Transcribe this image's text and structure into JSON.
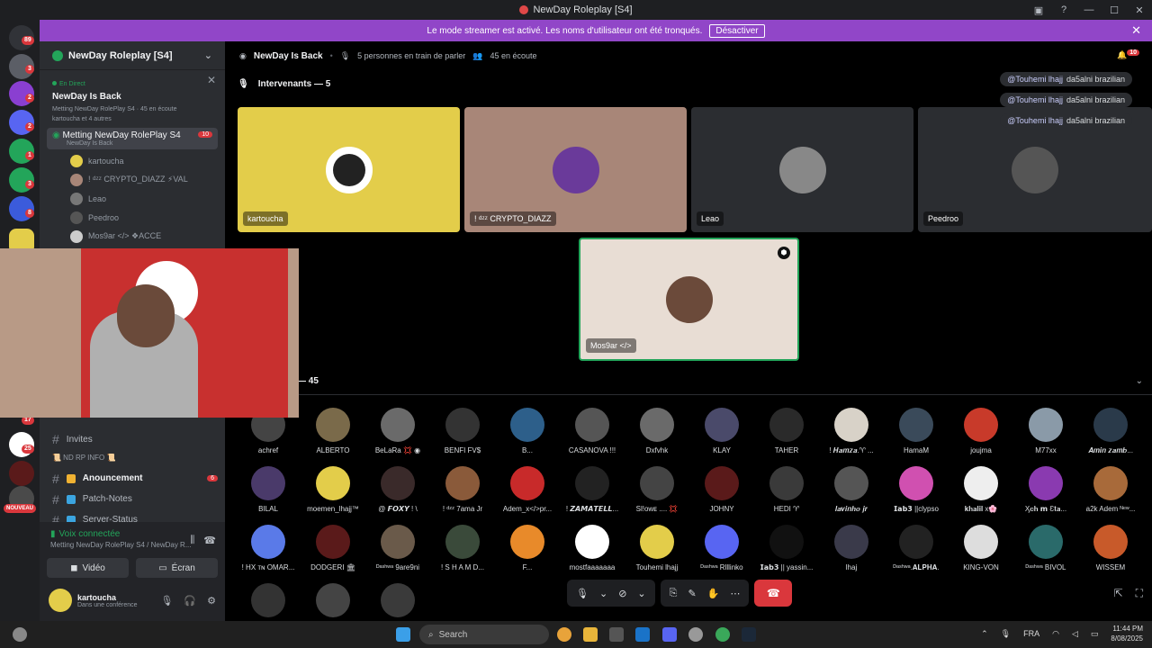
{
  "window": {
    "title": "NewDay Roleplay [S4]"
  },
  "banner": {
    "text": "Le mode streamer est activé. Les noms d'utilisateur ont été tronqués.",
    "button": "Désactiver"
  },
  "guild_badges": [
    "89",
    "3",
    "2",
    "2",
    "1",
    "3",
    "8",
    "17",
    "25",
    "NOUVEAU"
  ],
  "sidebar": {
    "server_name": "NewDay Roleplay [S4]",
    "live_label": "En Direct",
    "stage_title": "NewDay Is Back",
    "stage_meta": "Metting NewDay RolePlay S4 · 45 en écoute",
    "stage_users": "kartoucha et 4 autres",
    "active_channel": "Metting NewDay RolePlay S4",
    "active_channel_sub": "NewDay Is Back",
    "active_badge": "10",
    "members": [
      "kartoucha",
      "! ᵈᶻᶻ CRYPTO_DIAZZ ⚡VAL",
      "Leao",
      "Peedroo",
      "Mos9ar </> ❖ACCE"
    ],
    "category": "📜 ND RP INFO 📜",
    "invites": "Invites",
    "channels": [
      {
        "label": "Anouncement",
        "badge": "6"
      },
      {
        "label": "Patch-Notes",
        "badge": ""
      },
      {
        "label": "Server-Status",
        "badge": ""
      }
    ],
    "voice_status": "Voix connectée",
    "voice_sub": "Metting NewDay RolePlay S4 / NewDay R...",
    "video_btn": "Vidéo",
    "screen_btn": "Écran",
    "user_name": "kartoucha",
    "user_status": "Dans une conférence"
  },
  "topbar": {
    "stage": "NewDay Is Back",
    "speaking": "5 personnes en train de parler",
    "listening": "45 en écoute",
    "notif": "10"
  },
  "speakers_header": "Intervenants — 5",
  "speakers": [
    {
      "name": "kartoucha",
      "color": "#e3cd4a"
    },
    {
      "name": "! ᵈᶻᶻ CRYPTO_DIAZZ",
      "color": "#a88678"
    },
    {
      "name": "Leao",
      "color": "#2b2d31"
    },
    {
      "name": "Peedroo",
      "color": "#2b2d31"
    },
    {
      "name": "Mos9ar </>",
      "color": "#e8ddd4"
    }
  ],
  "mentions": [
    {
      "at": "@Touhemi lhajj",
      "text": "da5alni brazilian"
    },
    {
      "at": "@Touhemi lhajj",
      "text": "da5alni brazilian"
    },
    {
      "at": "@Touhemi lhajj",
      "text": "da5alni brazilian"
    }
  ],
  "audience_header": "— 45",
  "audience": [
    "achref",
    "ALBERTO",
    "BeLaRa 💢 ◉",
    "BENFI FV$",
    "B...",
    "CASANOVA !!!",
    "Dxfvhk",
    "KLAY",
    "TAHER",
    "! 𝑯𝒂𝒎𝒛𝒂.♈ ...",
    "HamaM",
    "joujma",
    "M77xx",
    "𝑨𝒎𝒊𝒏 𝒛𝒂𝒎𝒃...",
    "BILAL",
    "moemen_lhajj™",
    "@ 𝙁𝙊𝙓𝙔 ! \\",
    "! ᵈᶻᶻ 7ama Jr",
    "Adem_x</>pr...",
    "! 𝙕𝘼𝙈𝘼𝙏𝙀𝙇𝙇...",
    "Sl!oᴡᴇ .... 💢",
    "JOHNY",
    "HEDI ♈",
    "𝒍𝒂𝒗𝒊𝒏𝒉𝒐 𝒋𝒓",
    "𝗜𝗮𝗯𝟯 ||clypso",
    "𝐤𝐡𝐚𝐥𝐢𝐥 x🌸",
    "Ӽ𝐜𝐡 𝗺 Ɛ𝐭𝐚...",
    "a2k Adem ᴺᵉʷ...",
    "! HX ᴛɴ OMAR...",
    "DODGERI 🏛",
    "ᴰᵃˢʰʷᵃ 9are9ni",
    "! S H A M D...",
    "F...",
    "mostfaaaaaaa",
    "Touhemi lhajj",
    "ᴰᵃˢʰʷᵃ Rlllinko",
    "𝗜𝗮𝗯𝟯 || yassin...",
    "lhaj",
    "ᴰᵃˢʰʷᵃ.𝐀𝐋𝐏𝐇𝐀.",
    "KING-VON",
    "ᴰᵃˢʰʷᵃ BIVOL",
    "WISSEM",
    "",
    "",
    ""
  ],
  "taskbar": {
    "search_placeholder": "Search",
    "lang": "FRA",
    "time": "11:44 PM",
    "date": "8/08/2025"
  }
}
